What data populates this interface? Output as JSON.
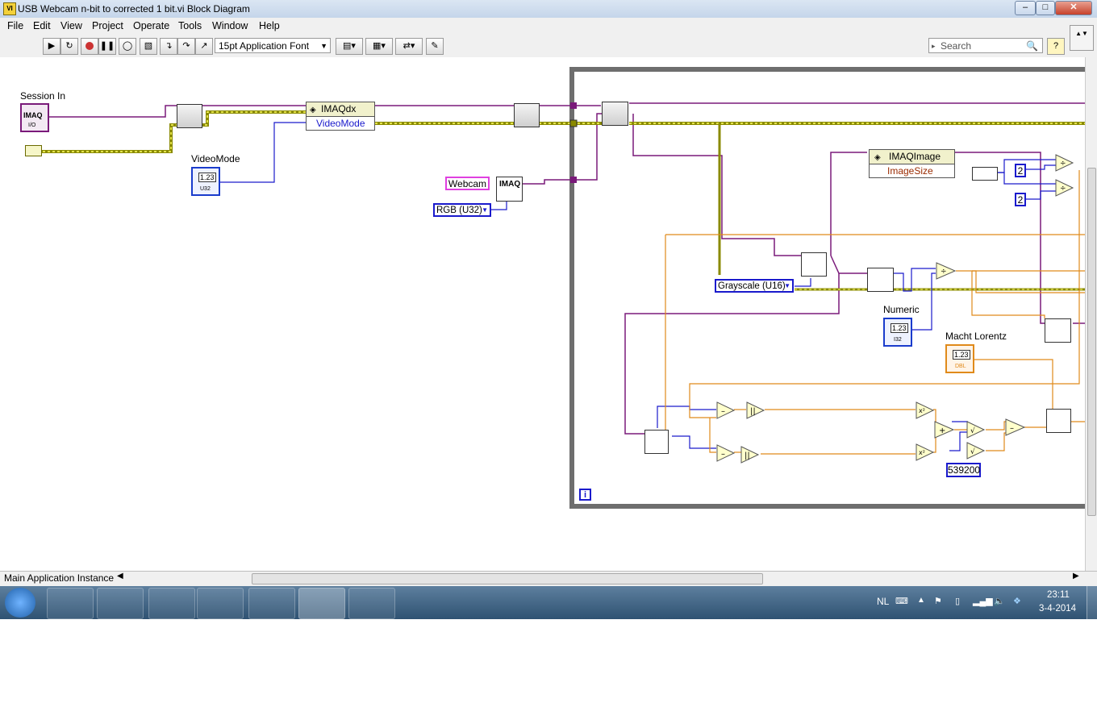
{
  "window": {
    "title": "USB Webcam n-bit to corrected 1 bit.vi Block Diagram",
    "app_icon": "labview-vi-icon"
  },
  "menu": [
    "File",
    "Edit",
    "View",
    "Project",
    "Operate",
    "Tools",
    "Window",
    "Help"
  ],
  "toolbar": {
    "font_label": "15pt Application Font",
    "search_placeholder": "Search",
    "help_label": "?"
  },
  "diagram": {
    "session_in_label": "Session In",
    "session_in_terminal": "IMAQ",
    "session_in_sub": "I/O",
    "videomode_label": "VideoMode",
    "videomode_terminal": "1.23",
    "videomode_type": "U32",
    "imaqdx_node_title": "IMAQdx",
    "imaqdx_node_prop": "VideoMode",
    "webcam_const": "Webcam",
    "imaq_create": "IMAQ",
    "rgb_const": "RGB (U32)",
    "imaqimage_title": "IMAQImage",
    "imaqimage_prop": "ImageSize",
    "const_2a": "2",
    "const_2b": "2",
    "grayscale_const": "Grayscale (U16)",
    "numeric_label": "Numeric",
    "numeric_terminal": "1.23",
    "numeric_type": "I32",
    "macht_label": "Macht Lorentz",
    "macht_terminal": "1.23",
    "macht_type": "DBL",
    "const_539200": "539200",
    "loop_iteration": "i"
  },
  "statusbar": {
    "context": "Main Application Instance"
  },
  "taskbar": {
    "apps": [
      "media-player-icon",
      "chrome-icon",
      "file-explorer-icon",
      "word-icon",
      "steam-icon",
      "labview-icon",
      "paint-icon"
    ],
    "language": "NL",
    "time": "23:11",
    "date": "3-4-2014"
  },
  "colors": {
    "wire_purple": "#7a1a7a",
    "wire_blue": "#1a1acc",
    "wire_orange": "#e08a1a",
    "wire_yellow_black": "#b8b800",
    "loop_border": "#6e6e6e"
  }
}
